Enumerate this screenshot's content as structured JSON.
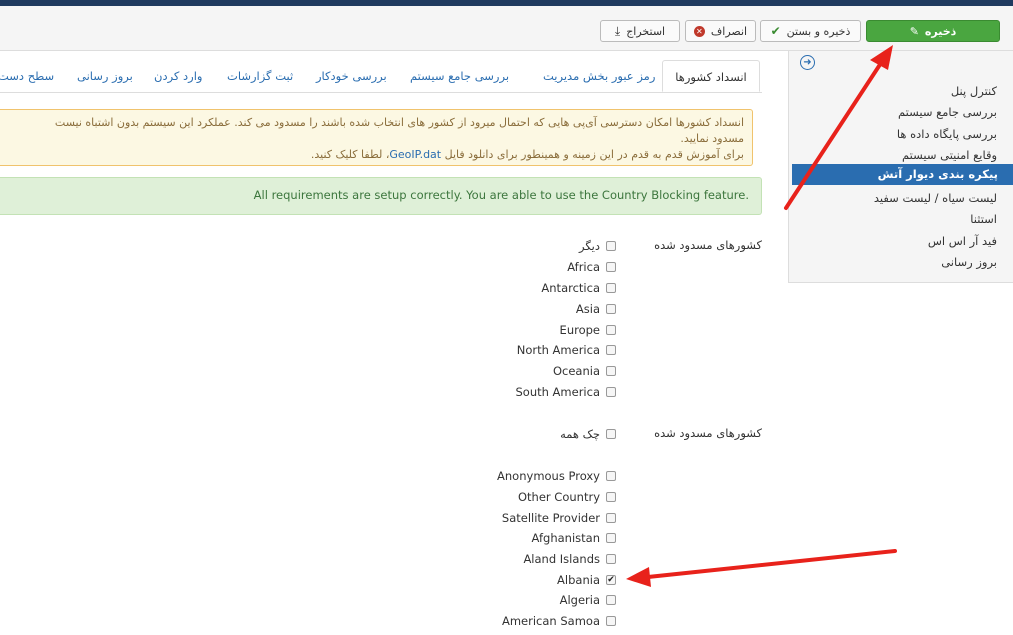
{
  "toolbar": {
    "save_label": "ذخیره",
    "save_close_label": "ذخیره و بستن",
    "cancel_label": "انصراف",
    "export_label": "استخراج"
  },
  "sidebar": {
    "items": [
      {
        "label": "کنترل پنل"
      },
      {
        "label": "بررسی جامع سیستم"
      },
      {
        "label": "بررسی پایگاه داده ها"
      },
      {
        "label": "وقایع امنیتی سیستم"
      },
      {
        "label": "پیکره بندی دیوار آتش",
        "active": true
      },
      {
        "label": "لیست سیاه / لیست سفید"
      },
      {
        "label": "استثنا"
      },
      {
        "label": "فید آر اس اس"
      },
      {
        "label": "بروز رسانی"
      }
    ]
  },
  "tabs": [
    {
      "label": "انسداد کشورها",
      "active": true
    },
    {
      "label": "رمز عبور بخش مدیریت"
    },
    {
      "label": "بررسی جامع سیستم"
    },
    {
      "label": "بررسی خودکار"
    },
    {
      "label": "ثبت گزارشات"
    },
    {
      "label": "وارد کردن"
    },
    {
      "label": "بروز رسانی"
    },
    {
      "label": "سطح دست"
    }
  ],
  "warning": {
    "line1": "انسداد کشورها امکان دسترسی آی‌پی هایی که احتمال میرود از کشور های انتخاب شده باشند را مسدود می کند. عملکرد این سیستم بدون اشتباه نیست",
    "line2": "مسدود نمایید.",
    "line3_prefix": "برای آموزش قدم به قدم در این زمینه و همینطور برای دانلود فایل",
    "line3_link": "GeoIP.dat",
    "line3_suffix": "، لطفا کلیک کنید."
  },
  "success": {
    "text": "All requirements are setup correctly. You are able to use the Country Blocking feature."
  },
  "continents": {
    "label": "کشورهای مسدود شده",
    "options": [
      {
        "label": "دیگر",
        "checked": false
      },
      {
        "label": "Africa",
        "checked": false
      },
      {
        "label": "Antarctica",
        "checked": false
      },
      {
        "label": "Asia",
        "checked": false
      },
      {
        "label": "Europe",
        "checked": false
      },
      {
        "label": "North America",
        "checked": false
      },
      {
        "label": "Oceania",
        "checked": false
      },
      {
        "label": "South America",
        "checked": false
      }
    ]
  },
  "countries": {
    "label": "کشورهای مسدود شده",
    "check_all_label": "چک همه",
    "options": [
      {
        "label": "Anonymous Proxy",
        "checked": false
      },
      {
        "label": "Other Country",
        "checked": false
      },
      {
        "label": "Satellite Provider",
        "checked": false
      },
      {
        "label": "Afghanistan",
        "checked": false
      },
      {
        "label": "Aland Islands",
        "checked": false
      },
      {
        "label": "Albania",
        "checked": true
      },
      {
        "label": "Algeria",
        "checked": false
      },
      {
        "label": "American Samoa",
        "checked": false
      }
    ]
  },
  "colors": {
    "accent": "#2a6db0",
    "save_green": "#4aa640",
    "annotation_red": "#e8221b"
  }
}
